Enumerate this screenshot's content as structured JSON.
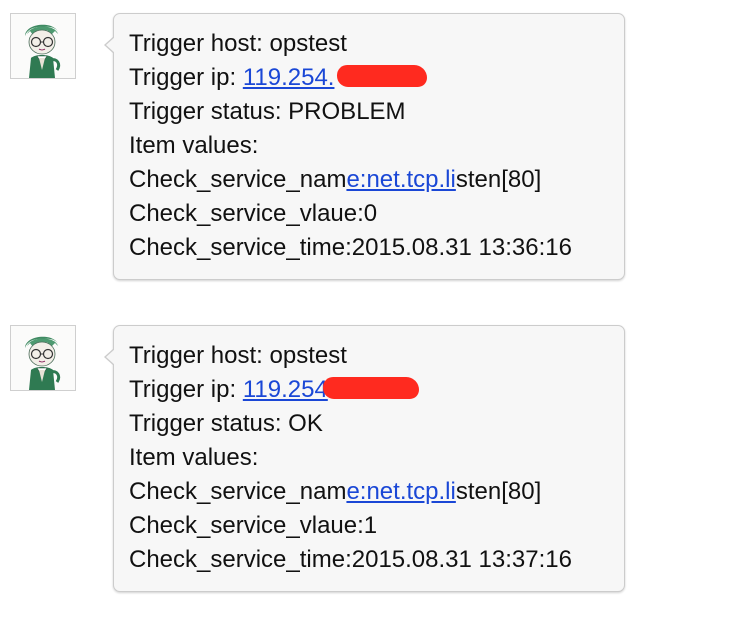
{
  "messages": [
    {
      "host_label": "Trigger host: ",
      "host": "opstest",
      "ip_label": "Trigger ip: ",
      "ip": "119.254.",
      "status_label": "Trigger status: ",
      "status": "PROBLEM",
      "item_values": "Item values:",
      "svc_prefix": "Check_service_nam",
      "svc_link": "e:net.tcp.li",
      "svc_suffix": "sten[80]",
      "vlaue": "Check_service_vlaue:0",
      "time": "Check_service_time:2015.08.31 13:36:16"
    },
    {
      "host_label": "Trigger host: ",
      "host": "opstest",
      "ip_label": "Trigger ip: ",
      "ip": "119.254",
      "status_label": "Trigger status: ",
      "status": "OK",
      "item_values": "Item values:",
      "svc_prefix": "Check_service_nam",
      "svc_link": "e:net.tcp.li",
      "svc_suffix": "sten[80]",
      "vlaue": "Check_service_vlaue:1",
      "time": "Check_service_time:2015.08.31 13:37:16"
    }
  ],
  "colors": {
    "link": "#1a47d6",
    "redaction": "#ff2a1f",
    "bubble_bg": "#f7f7f7"
  },
  "icons": {
    "avatar": "cartoon-boy-avatar"
  }
}
